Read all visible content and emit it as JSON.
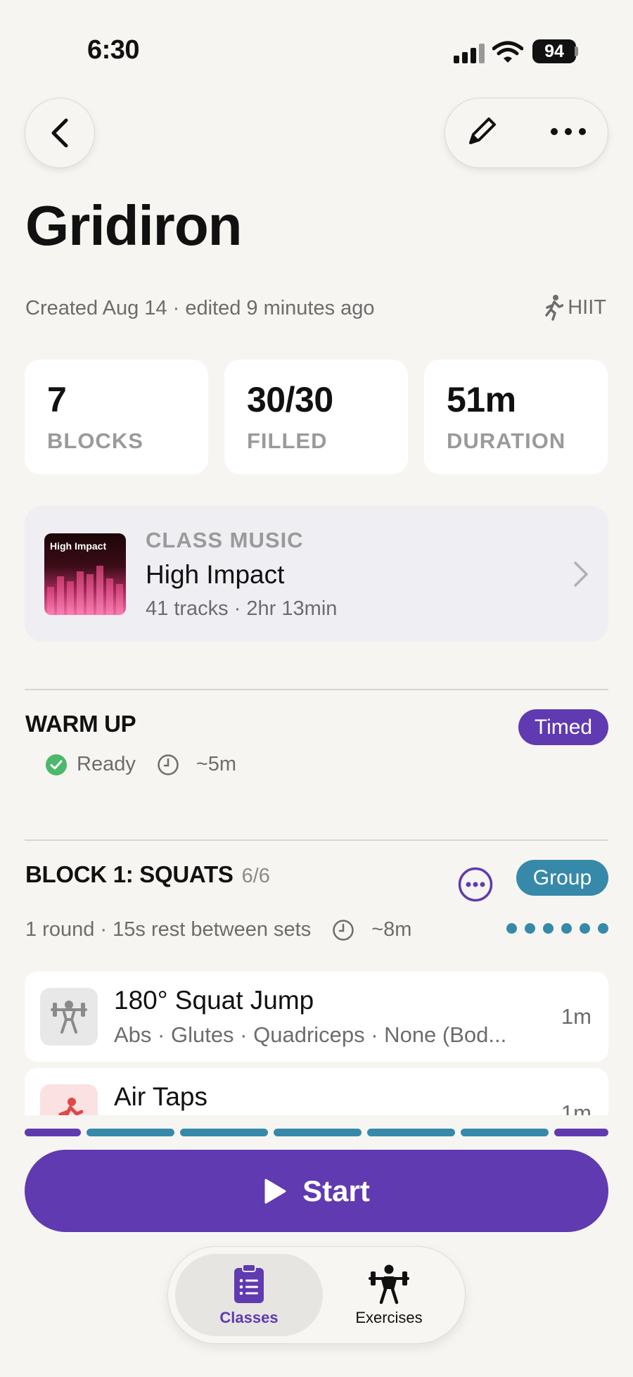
{
  "status": {
    "time": "6:30",
    "battery": "94"
  },
  "header": {
    "title": "Gridiron",
    "meta": "Created Aug 14 · edited 9 minutes ago",
    "category": "HIIT"
  },
  "stats": [
    {
      "value": "7",
      "label": "BLOCKS"
    },
    {
      "value": "30/30",
      "label": "FILLED"
    },
    {
      "value": "51m",
      "label": "DURATION"
    }
  ],
  "music": {
    "kicker": "CLASS MUSIC",
    "title": "High Impact",
    "subtitle": "41 tracks · 2hr 13min",
    "artwork_text": "High Impact"
  },
  "warmup": {
    "title": "WARM UP",
    "badge": "Timed",
    "status": "Ready",
    "duration": "~5m"
  },
  "block1": {
    "title": "BLOCK 1: SQUATS",
    "count": "6/6",
    "badge": "Group",
    "meta": "1 round · 15s rest between sets",
    "duration": "~8m",
    "dot_count": 6,
    "exercises": [
      {
        "name": "180° Squat Jump",
        "detail": "Abs · Glutes · Quadriceps · None (Bod...",
        "duration": "1m",
        "icon": "weightlift-icon"
      },
      {
        "name": "Air Taps",
        "detail": "",
        "duration": "1m",
        "icon": "running-icon"
      }
    ]
  },
  "colors": {
    "accent_purple": "#603ab0",
    "group_blue": "#3789a9",
    "ready_green": "#4cb86a"
  },
  "progress_segments": [
    "purple",
    "blue",
    "blue",
    "blue",
    "blue",
    "blue",
    "purple"
  ],
  "actions": {
    "start": "Start"
  },
  "tabs": [
    {
      "label": "Classes",
      "icon": "clipboard-list-icon",
      "selected": true
    },
    {
      "label": "Exercises",
      "icon": "weightlifter-icon",
      "selected": false
    }
  ]
}
